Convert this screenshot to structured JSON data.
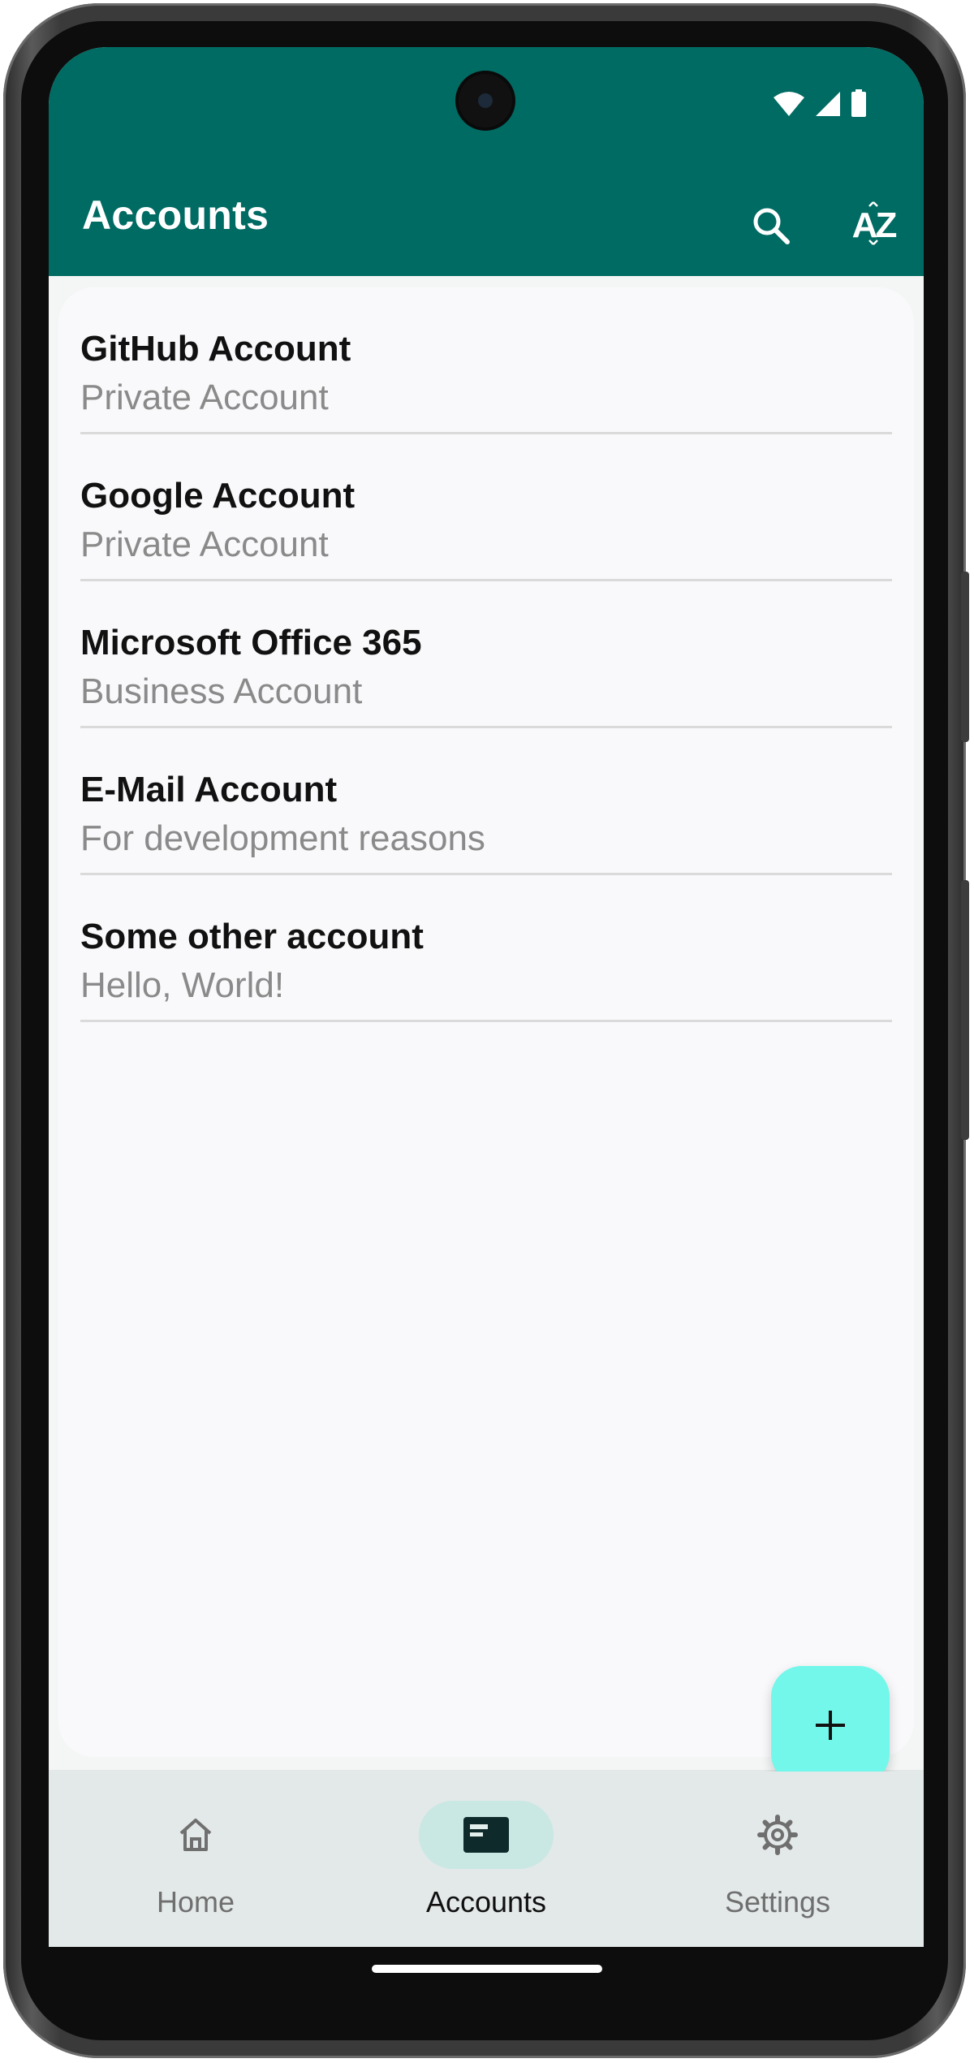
{
  "app_bar": {
    "title": "Accounts",
    "search_icon": "search-icon",
    "sort_icon": "sort-alphabetical-icon",
    "sort_glyph": "AZ",
    "color": "#006b63"
  },
  "status_bar": {
    "icons": [
      "wifi-icon",
      "signal-icon",
      "battery-icon"
    ]
  },
  "accounts": [
    {
      "name": "GitHub Account",
      "description": "Private Account"
    },
    {
      "name": "Google Account",
      "description": "Private Account"
    },
    {
      "name": "Microsoft Office 365",
      "description": "Business Account"
    },
    {
      "name": "E-Mail Account",
      "description": "For development reasons"
    },
    {
      "name": "Some other account",
      "description": "Hello, World!"
    }
  ],
  "fab": {
    "icon": "plus-icon",
    "color": "#72f7ea"
  },
  "bottom_nav": {
    "items": [
      {
        "label": "Home",
        "icon": "home-icon",
        "active": false
      },
      {
        "label": "Accounts",
        "icon": "account-card-icon",
        "active": true
      },
      {
        "label": "Settings",
        "icon": "gear-icon",
        "active": false
      }
    ],
    "active_indicator_color": "#c9e8e3"
  }
}
